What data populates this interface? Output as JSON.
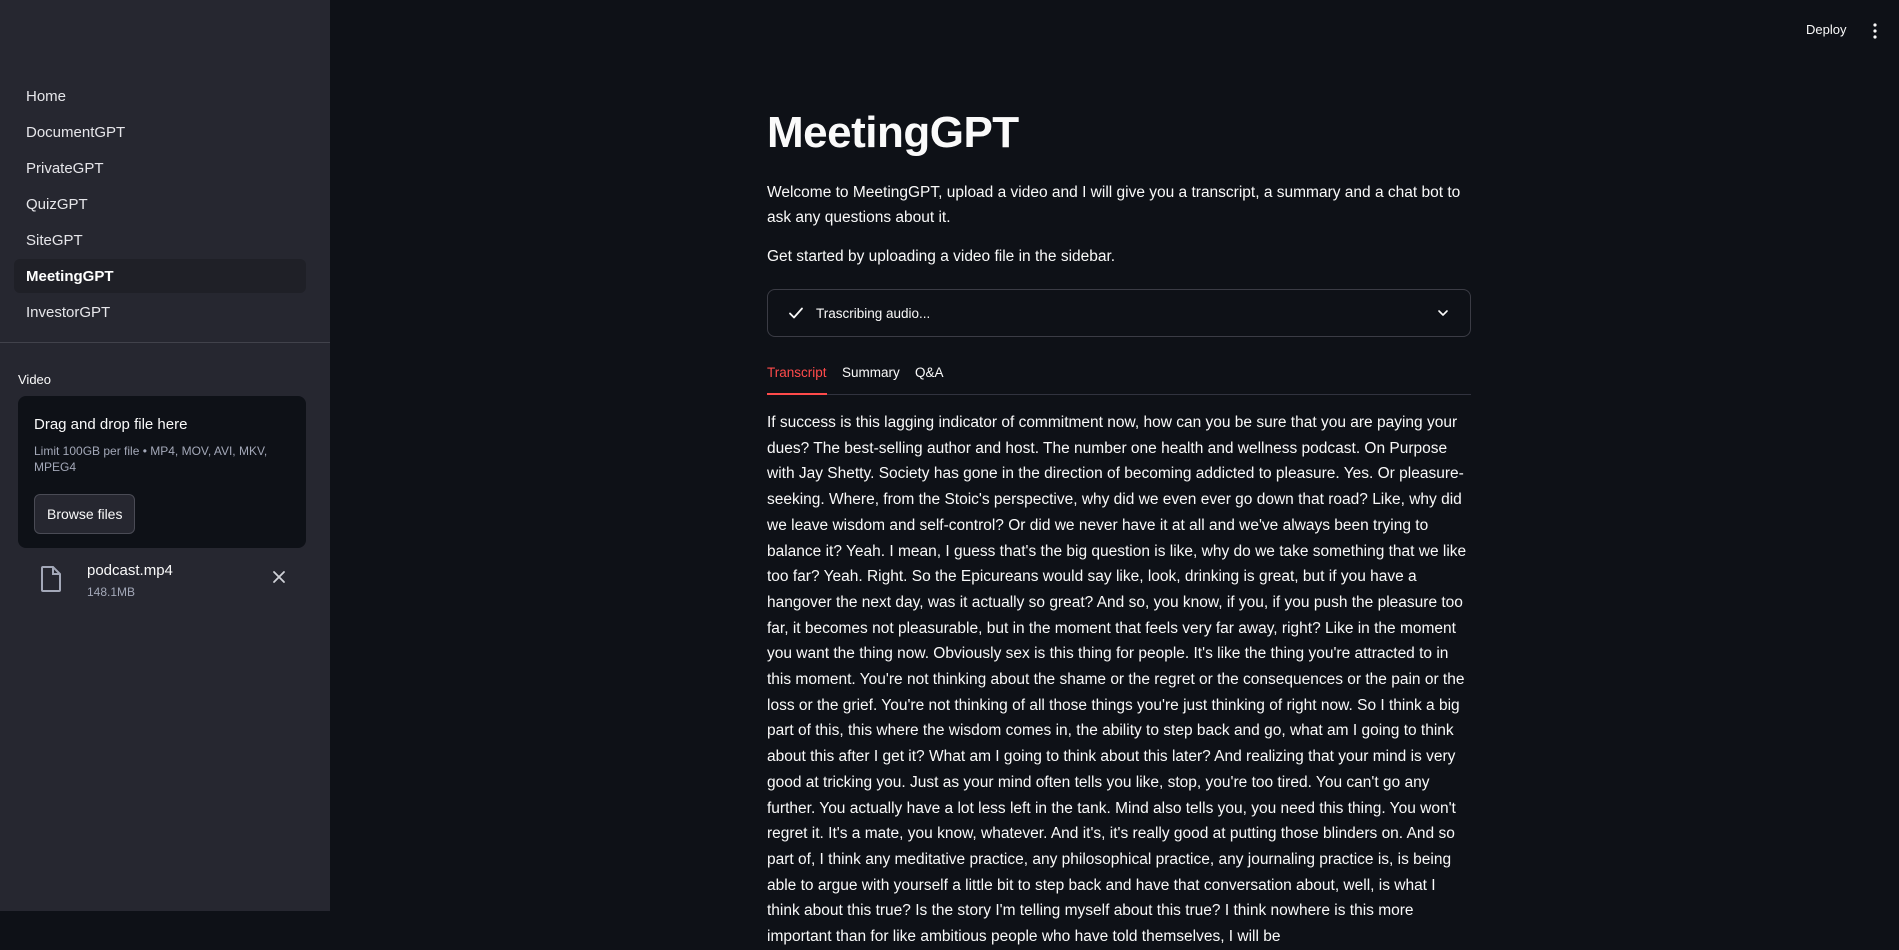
{
  "header": {
    "deploy_label": "Deploy"
  },
  "sidebar": {
    "nav": [
      {
        "label": "Home",
        "active": false
      },
      {
        "label": "DocumentGPT",
        "active": false
      },
      {
        "label": "PrivateGPT",
        "active": false
      },
      {
        "label": "QuizGPT",
        "active": false
      },
      {
        "label": "SiteGPT",
        "active": false
      },
      {
        "label": "MeetingGPT",
        "active": true
      },
      {
        "label": "InvestorGPT",
        "active": false
      }
    ],
    "video_label": "Video",
    "dropzone": {
      "title": "Drag and drop file here",
      "limit": "Limit 100GB per file • MP4, MOV, AVI, MKV, MPEG4",
      "browse_label": "Browse files"
    },
    "file": {
      "name": "podcast.mp4",
      "size": "148.1MB",
      "icon": "file-icon"
    }
  },
  "main": {
    "title": "MeetingGPT",
    "intro": "Welcome to MeetingGPT, upload a video and I will give you a transcript, a summary and a chat bot to ask any questions about it.",
    "get_started": "Get started by uploading a video file in the sidebar.",
    "status": {
      "label": "Trascribing audio...",
      "state": "complete"
    },
    "tabs": [
      {
        "label": "Transcript",
        "active": true
      },
      {
        "label": "Summary",
        "active": false
      },
      {
        "label": "Q&A",
        "active": false
      }
    ],
    "transcript": "If success is this lagging indicator of commitment now, how can you be sure that you are paying your dues? The best-selling author and host. The number one health and wellness podcast. On Purpose with Jay Shetty. Society has gone in the direction of becoming addicted to pleasure. Yes. Or pleasure-seeking. Where, from the Stoic's perspective, why did we even ever go down that road? Like, why did we leave wisdom and self-control? Or did we never have it at all and we've always been trying to balance it? Yeah. I mean, I guess that's the big question is like, why do we take something that we like too far? Yeah. Right. So the Epicureans would say like, look, drinking is great, but if you have a hangover the next day, was it actually so great? And so, you know, if you, if you push the pleasure too far, it becomes not pleasurable, but in the moment that feels very far away, right? Like in the moment you want the thing now. Obviously sex is this thing for people. It's like the thing you're attracted to in this moment. You're not thinking about the shame or the regret or the consequences or the pain or the loss or the grief. You're not thinking of all those things you're just thinking of right now. So I think a big part of this, this where the wisdom comes in, the ability to step back and go, what am I going to think about this after I get it? What am I going to think about this later? And realizing that your mind is very good at tricking you. Just as your mind often tells you like, stop, you're too tired. You can't go any further. You actually have a lot less left in the tank. Mind also tells you, you need this thing. You won't regret it. It's a mate, you know, whatever. And it's, it's really good at putting those blinders on. And so part of, I think any meditative practice, any philosophical practice, any journaling practice is, is being able to argue with yourself a little bit to step back and have that conversation about, well, is what I think about this true? Is the story I'm telling myself about this true? I think nowhere is this more important than for like ambitious people who have told themselves, I will be"
  },
  "colors": {
    "accent": "#ff4b4b",
    "sidebar_bg": "#262730",
    "main_bg": "#0e1117"
  }
}
